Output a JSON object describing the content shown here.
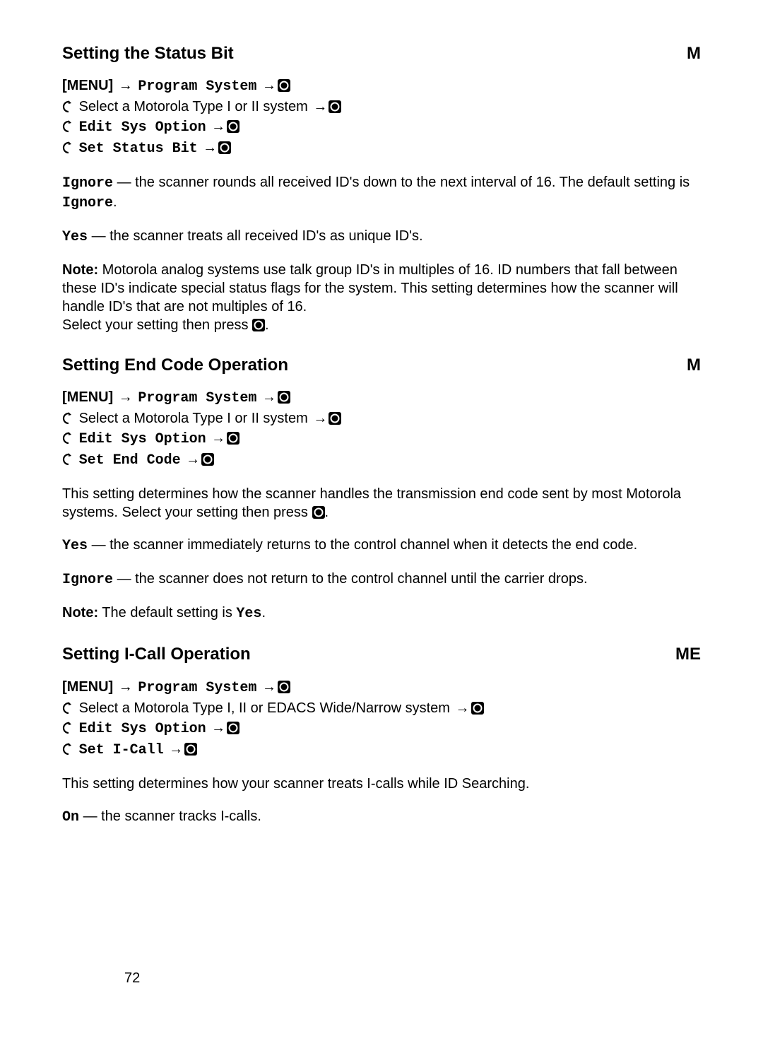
{
  "sections": [
    {
      "title": "Setting the Status Bit",
      "tag": "M",
      "nav": {
        "menu_label": "[MENU]",
        "step1": "Program System",
        "select_text": "Select a Motorola Type I or II system",
        "step2": "Edit Sys Option",
        "step3": "Set Status Bit"
      },
      "paras": [
        {
          "lead_mono": "Ignore",
          "text": " — the scanner rounds all received ID's down to the next interval of 16. The default setting is ",
          "tail_mono": "Ignore",
          "tail_text": "."
        },
        {
          "lead_mono": "Yes",
          "text": " — the scanner treats all received ID's as unique ID's."
        },
        {
          "lead_bold": "Note:",
          "text": " Motorola analog systems use talk group ID's in multiples of 16. ID numbers that fall between these ID's indicate special status flags for the system. This setting determines how the scanner will handle ID's that are not multiples of 16.",
          "extra_line": "Select your setting then press ",
          "extra_enter": true,
          "extra_tail": "."
        }
      ]
    },
    {
      "title": "Setting End Code Operation",
      "tag": "M",
      "nav": {
        "menu_label": "[MENU]",
        "step1": "Program System",
        "select_text": "Select a Motorola Type I or II system",
        "step2": "Edit Sys Option",
        "step3": "Set End Code"
      },
      "paras": [
        {
          "text_pre": "This setting determines how the scanner handles the transmission end code sent by most Motorola systems. Select your setting then press ",
          "inline_enter": true,
          "text_post": "."
        },
        {
          "lead_mono": "Yes",
          "text": " — the scanner immediately returns to the control channel when it detects the end code."
        },
        {
          "lead_mono": "Ignore",
          "text": " — the scanner does not return to the control channel until the carrier drops."
        },
        {
          "lead_bold": "Note:",
          "text": " The default setting is ",
          "tail_mono": "Yes",
          "tail_text": "."
        }
      ]
    },
    {
      "title": "Setting I-Call Operation",
      "tag": "ME",
      "nav": {
        "menu_label": "[MENU]",
        "step1": "Program System",
        "select_text": "Select a Motorola Type I, II or EDACS Wide/Narrow system",
        "step2": "Edit Sys Option",
        "step3": "Set I-Call"
      },
      "paras": [
        {
          "text_pre": "This setting determines how your scanner treats I-calls while ID Searching."
        },
        {
          "lead_mono": "On",
          "text": " — the scanner tracks I-calls."
        }
      ]
    }
  ],
  "page_number": "72",
  "icons": {
    "arrow": "→",
    "scroll_label": "scroll-icon",
    "enter_label": "enter-icon"
  }
}
